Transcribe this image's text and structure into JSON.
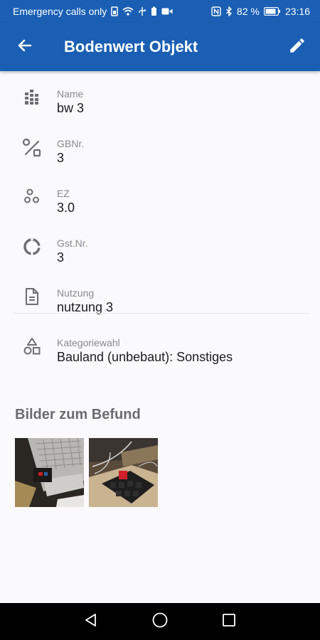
{
  "status_bar": {
    "carrier_text": "Emergency calls only",
    "battery_percent": "82 %",
    "time": "23:16"
  },
  "app_bar": {
    "title": "Bodenwert Objekt",
    "back_icon": "arrow-left-icon",
    "edit_icon": "pencil-icon",
    "background_color": "#1a5fb4"
  },
  "fields": [
    {
      "label": "Name",
      "value": "bw 3",
      "icon": "building-icon"
    },
    {
      "label": "GBNr.",
      "value": "3",
      "icon": "route-icon"
    },
    {
      "label": "EZ",
      "value": "3.0",
      "icon": "circles-icon"
    },
    {
      "label": "Gst.Nr.",
      "value": "3",
      "icon": "donut-icon"
    },
    {
      "label": "Nutzung",
      "value": "nutzung 3",
      "icon": "document-icon"
    },
    {
      "label": "Kategoriewahl",
      "value": "Bauland (unbebaut): Sonstiges",
      "icon": "shapes-icon"
    }
  ],
  "images_section": {
    "title": "Bilder zum Befund",
    "photos": [
      "laptop-photo",
      "keyboard-photo"
    ]
  },
  "nav_bar": {
    "buttons": [
      "back-triangle-icon",
      "home-circle-icon",
      "recents-square-icon"
    ]
  }
}
